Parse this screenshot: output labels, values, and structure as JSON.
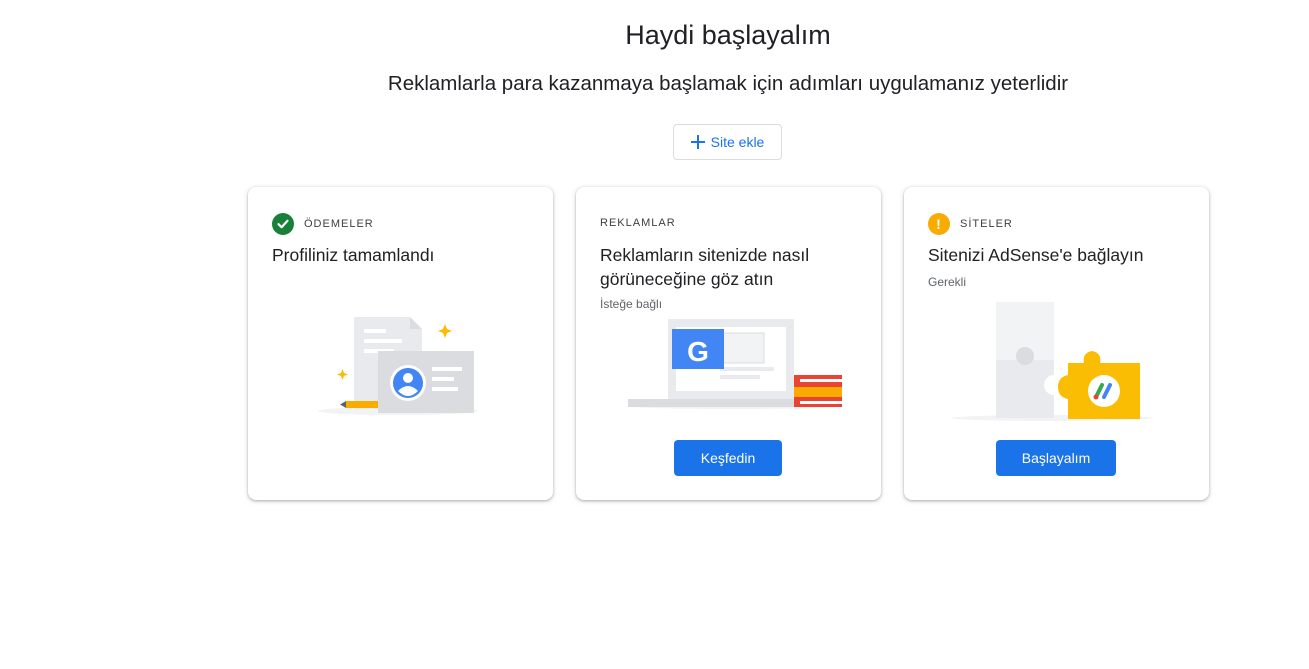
{
  "header": {
    "title": "Haydi başlayalım",
    "subtitle": "Reklamlarla para kazanmaya başlamak için adımları uygulamanız yeterlidir"
  },
  "add_site": {
    "label": "Site ekle"
  },
  "cards": [
    {
      "eyebrow": "ÖDEMELER",
      "status": "complete",
      "title": "Profiliniz tamamlandı"
    },
    {
      "eyebrow": "REKLAMLAR",
      "title": "Reklamların sitenizde nasıl görüneceğine göz atın",
      "note": "İsteğe bağlı",
      "button": "Keşfedin",
      "illustration_letter": "G"
    },
    {
      "eyebrow": "SİTELER",
      "status": "warning",
      "title": "Sitenizi AdSense'e bağlayın",
      "note": "Gerekli",
      "button": "Başlayalım"
    }
  ],
  "colors": {
    "primary": "#1a73e8",
    "success": "#188038",
    "warning": "#f9ab00"
  }
}
